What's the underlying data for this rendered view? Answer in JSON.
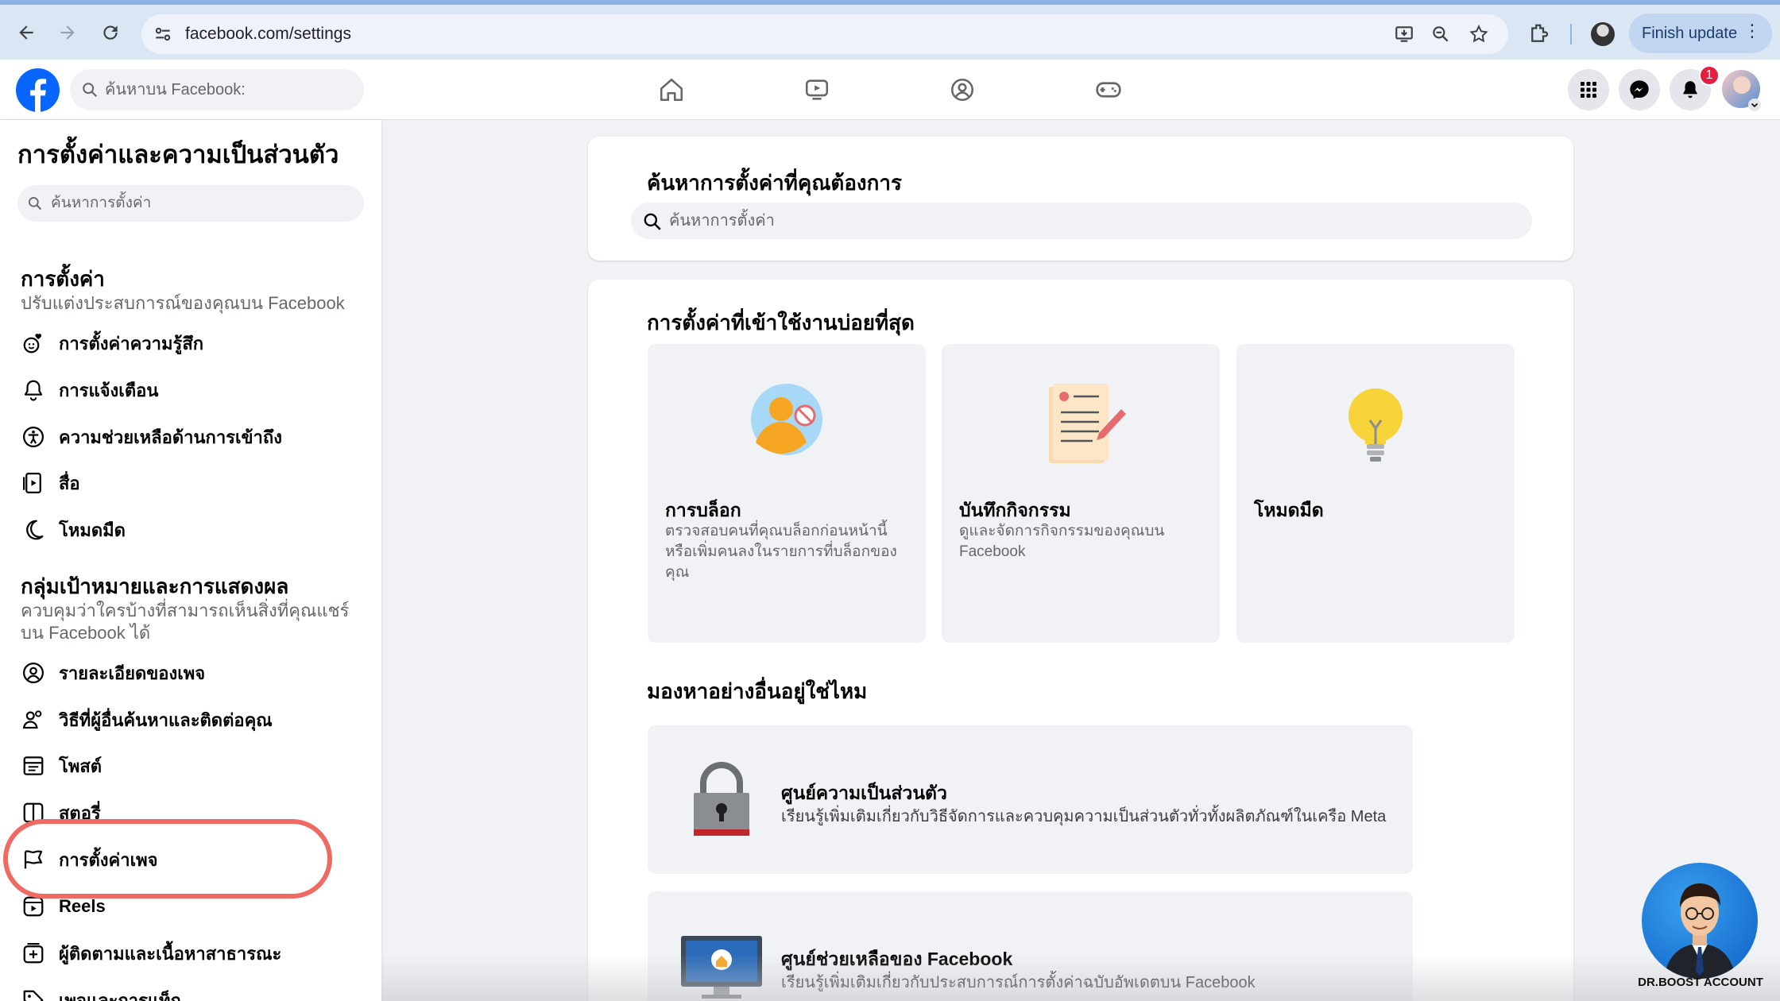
{
  "browser": {
    "url": "facebook.com/settings",
    "finish_update": "Finish update"
  },
  "fb": {
    "search_placeholder": "ค้นหาบน Facebook:",
    "notification_count": "1"
  },
  "sidebar": {
    "title": "การตั้งค่าและความเป็นส่วนตัว",
    "search_placeholder": "ค้นหาการตั้งค่า",
    "section1": {
      "title": "การตั้งค่า",
      "desc": "ปรับแต่งประสบการณ์ของคุณบน Facebook",
      "items": [
        {
          "label": "การตั้งค่าความรู้สึก",
          "icon": "reactions-icon"
        },
        {
          "label": "การแจ้งเตือน",
          "icon": "bell-icon"
        },
        {
          "label": "ความช่วยเหลือด้านการเข้าถึง",
          "icon": "accessibility-icon"
        },
        {
          "label": "สื่อ",
          "icon": "media-icon"
        },
        {
          "label": "โหมดมืด",
          "icon": "moon-icon"
        }
      ]
    },
    "section2": {
      "title": "กลุ่มเป้าหมายและการแสดงผล",
      "desc": "ควบคุมว่าใครบ้างที่สามารถเห็นสิ่งที่คุณแชร์บน Facebook ได้",
      "items": [
        {
          "label": "รายละเอียดของเพจ",
          "icon": "profile-icon"
        },
        {
          "label": "วิธีที่ผู้อื่นค้นหาและติดต่อคุณ",
          "icon": "people-icon"
        },
        {
          "label": "โพสต์",
          "icon": "posts-icon"
        },
        {
          "label": "สตอรี่",
          "icon": "stories-icon"
        },
        {
          "label": "การตั้งค่าเพจ",
          "icon": "flag-icon"
        },
        {
          "label": "Reels",
          "icon": "reels-icon"
        },
        {
          "label": "ผู้ติดตามและเนื้อหาสาธารณะ",
          "icon": "followers-icon"
        },
        {
          "label": "เพจและการแท็ก",
          "icon": "tag-icon"
        }
      ]
    }
  },
  "main": {
    "search_card": {
      "title": "ค้นหาการตั้งค่าที่คุณต้องการ",
      "placeholder": "ค้นหาการตั้งค่า"
    },
    "frequent": {
      "title": "การตั้งค่าที่เข้าใช้งานบ่อยที่สุด",
      "tiles": [
        {
          "title": "การบล็อก",
          "desc": "ตรวจสอบคนที่คุณบล็อกก่อนหน้านี้ หรือเพิ่มคนลงในรายการที่บล็อกของคุณ"
        },
        {
          "title": "บันทึกกิจกรรม",
          "desc": "ดูและจัดการกิจกรรมของคุณบน Facebook"
        },
        {
          "title": "โหมดมืด",
          "desc": ""
        }
      ]
    },
    "more": {
      "title": "มองหาอย่างอื่นอยู่ใช่ไหม",
      "rows": [
        {
          "title": "ศูนย์ความเป็นส่วนตัว",
          "desc": "เรียนรู้เพิ่มเติมเกี่ยวกับวิธีจัดการและควบคุมความเป็นส่วนตัวทั่วทั้งผลิตภัณฑ์ในเครือ Meta"
        },
        {
          "title": "ศูนย์ช่วยเหลือของ Facebook",
          "desc": "เรียนรู้เพิ่มเติมเกี่ยวกับประสบการณ์การตั้งค่าฉบับอัพเดตบน Facebook"
        }
      ]
    }
  },
  "watermark": {
    "text": "DR.BOOST ACCOUNT"
  },
  "colors": {
    "fb_blue": "#0866ff",
    "highlight": "#ef6a62",
    "text_secondary": "#65676b"
  }
}
